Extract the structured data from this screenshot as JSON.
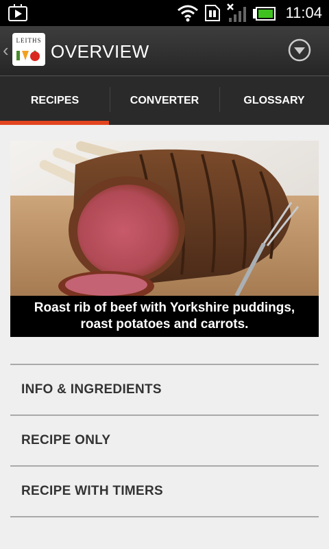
{
  "status_bar": {
    "time": "11:04",
    "icons": [
      "play-store-icon",
      "wifi-icon",
      "sim-icon",
      "signal-icon",
      "battery-icon"
    ]
  },
  "action_bar": {
    "title": "OVERVIEW",
    "logo_text": "LEITHS",
    "icons": [
      "back-chevron-icon",
      "app-logo",
      "overflow-dropdown-icon"
    ]
  },
  "tabs": [
    {
      "label": "RECIPES",
      "selected": true
    },
    {
      "label": "CONVERTER",
      "selected": false
    },
    {
      "label": "GLOSSARY",
      "selected": false
    }
  ],
  "recipe": {
    "caption_line1": "Roast rib of beef with Yorkshire puddings,",
    "caption_line2": "roast potatoes and carrots."
  },
  "menu": [
    {
      "label": "INFO & INGREDIENTS"
    },
    {
      "label": "RECIPE ONLY"
    },
    {
      "label": "RECIPE WITH TIMERS"
    }
  ],
  "colors": {
    "accent": "#e2451f",
    "tab_bar": "#2a2a2a",
    "background": "#efefef"
  }
}
